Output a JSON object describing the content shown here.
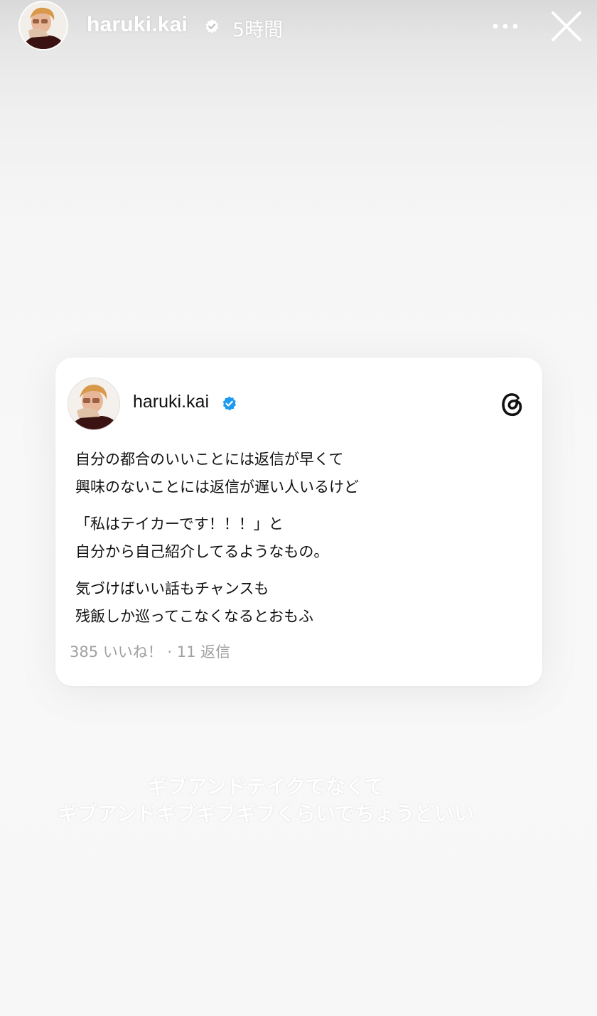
{
  "header": {
    "username": "haruki.kai",
    "time_ago": "5時間",
    "more_icon": "more-dots-icon",
    "close_icon": "close-icon"
  },
  "card": {
    "username": "haruki.kai",
    "verified_color": "#1d9bf0",
    "app_icon": "threads-logo-icon",
    "paragraphs": [
      [
        "自分の都合のいいことには返信が早くて",
        "興味のないことには返信が遅い人いるけど"
      ],
      [
        "「私はテイカーです！！！」と",
        "自分から自己紹介してるようなもの。"
      ],
      [
        "気づけばいい話もチャンスも",
        "残飯しか巡ってこなくなるとおもふ"
      ]
    ],
    "stats": "385 いいね！ · 11 返信"
  },
  "caption": {
    "lines": [
      "ギブアンドテイクでなくて",
      "ギブアンドギブギブギブくらいでちょうどいい"
    ]
  },
  "colors": {
    "stats_text": "#a0a0a0",
    "body_text": "#111111",
    "background": "#f8f8f8"
  }
}
